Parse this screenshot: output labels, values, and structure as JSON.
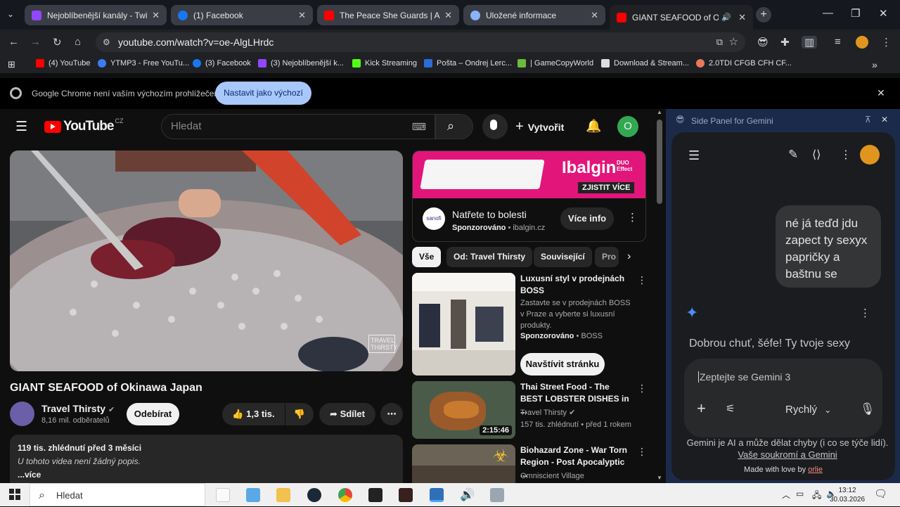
{
  "tabs": [
    {
      "title": "Nejoblíbenější kanály - Twitch",
      "color": "#9147ff"
    },
    {
      "title": "(1) Facebook",
      "color": "#1877f2"
    },
    {
      "title": "The Peace She Guards | Ambien",
      "color": "#ff0000"
    },
    {
      "title": "Uložené informace",
      "color": "#8ab4f8"
    },
    {
      "title": "GIANT SEAFOOD of Okinaw",
      "color": "#ff0000"
    }
  ],
  "address": "youtube.com/watch?v=oe-AlgLHrdc",
  "bookmarks": [
    {
      "label": "(4) YouTube",
      "color": "#ff0000"
    },
    {
      "label": "YTMP3 - Free YouTu...",
      "color": "#3d7bf5"
    },
    {
      "label": "(3) Facebook",
      "color": "#1877f2"
    },
    {
      "label": "(3) Nejoblíbenější k...",
      "color": "#9147ff"
    },
    {
      "label": "Kick Streaming",
      "color": "#53fc18"
    },
    {
      "label": "Pošta – Ondrej Lerc...",
      "color": "#2a6cd8"
    },
    {
      "label": "| GameCopyWorld",
      "color": "#6cbb3c"
    },
    {
      "label": "Download & Stream...",
      "color": "#dddddd"
    },
    {
      "label": "2.0TDI CFGB CFH CF...",
      "color": "#e8795a"
    }
  ],
  "infobar": {
    "text": "Google Chrome není vaším výchozím prohlížečem",
    "button": "Nastavit jako výchozí"
  },
  "youtube": {
    "region": "CZ",
    "logo": "YouTube",
    "search_placeholder": "Hledat",
    "create": "Vytvořit",
    "avatar_letter": "O",
    "video_title": "GIANT SEAFOOD of Okinawa Japan",
    "watermark": "TRAVEL THIRSTY",
    "channel": "Travel Thirsty",
    "subscribers": "8,16 mil. odběratelů",
    "subscribe": "Odebírat",
    "likes": "1,3 tis.",
    "share": "Sdílet",
    "desc_stats": "119 tis. zhlédnutí  před 3 měsíci",
    "desc_text": "U tohoto videa není žádný popis.",
    "desc_more": "...více"
  },
  "ad": {
    "brand": "Ibalgin",
    "badge": "DUO Effect",
    "cta_banner": "ZJISTIT VÍCE",
    "title": "Natřete to bolesti",
    "sponsored": "Sponzorováno",
    "domain": "ibalgin.cz",
    "button": "Více info",
    "logo_text": "sanofi"
  },
  "chips": [
    "Vše",
    "Od: Travel Thirsty",
    "Související",
    "Pro"
  ],
  "recs": [
    {
      "title": "Luxusní styl v prodejnách BOSS",
      "desc": "Zastavte se v prodejnách BOSS v Praze a vyberte si luxusní produkty.",
      "meta": "Sponzorováno",
      "meta2": "BOSS",
      "button": "Navštívit stránku"
    },
    {
      "title": "Thai Street Food - The BEST LOBSTER DISHES in ...",
      "channel": "Travel Thirsty",
      "stats": "157 tis. zhlédnutí  •  před 1 rokem",
      "duration": "2:15:46"
    },
    {
      "title": "Biohazard Zone - War Torn Region - Post Apocalyptic ...",
      "channel": "Omniscient Village"
    }
  ],
  "gemini": {
    "header": "Side Panel for Gemini",
    "user_message": "né já teďd jdu zapect ty sexyx papričky a baštnu se",
    "response_preview": "Dobrou chuť, šéfe! Ty tvoje sexy",
    "input_placeholder": "Zeptejte se Gemini 3",
    "mode": "Rychlý",
    "disclaimer": "Gemini je AI a může dělat chyby (i co se týče lidí).",
    "privacy_link": "Vaše soukromí a Gemini",
    "credit": "Made with love by",
    "credit_author": "orlie"
  },
  "taskbar": {
    "search": "Hledat",
    "time": "13:12",
    "date": "30.03.2026"
  }
}
